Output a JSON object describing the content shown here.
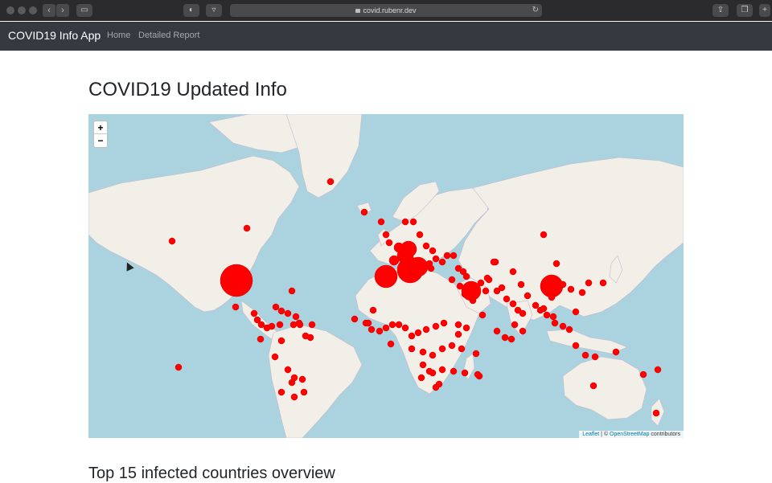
{
  "browser": {
    "url": "covid.rubenr.dev",
    "back_icon": "chevron-left-icon",
    "forward_icon": "chevron-right-icon"
  },
  "navbar": {
    "brand": "COVID19 Info App",
    "links": [
      "Home",
      "Detailed Report"
    ]
  },
  "page": {
    "title": "COVID19 Updated Info",
    "section_title": "Top 15 infected countries overview"
  },
  "map": {
    "zoom_in": "+",
    "zoom_out": "−",
    "attribution_leaflet": "Leaflet",
    "attribution_sep": " | © ",
    "attribution_osm": "OpenStreetMap",
    "attribution_tail": " contributors",
    "marker_color": "#ff0000",
    "water_color": "#aad3df",
    "land_color": "#f2efe9"
  }
}
